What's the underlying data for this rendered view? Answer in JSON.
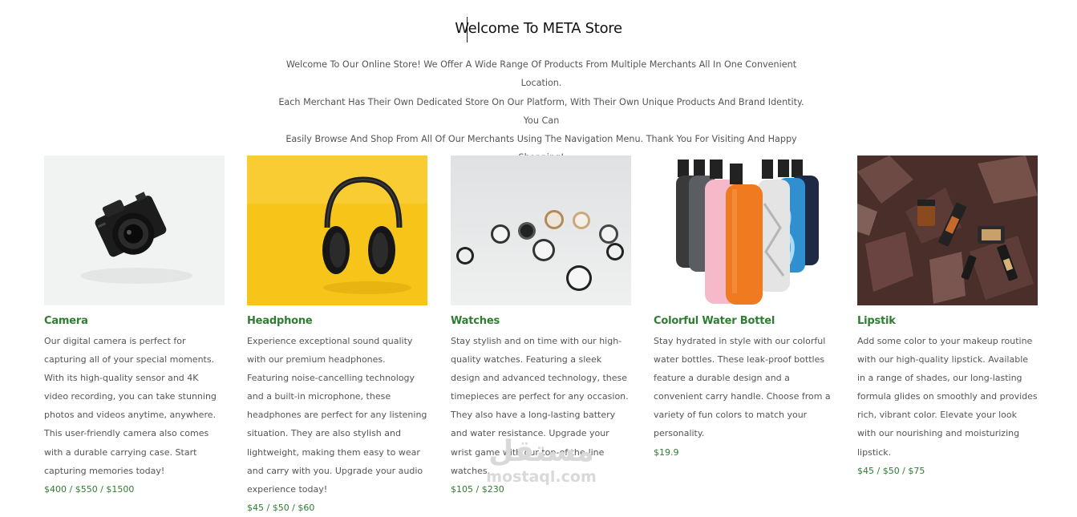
{
  "header": {
    "title": "Welcome To META Store",
    "intro_lines": [
      "Welcome To Our Online Store! We Offer A Wide Range Of Products From Multiple Merchants All In One Convenient Location.",
      "Each Merchant Has Their Own Dedicated Store On Our Platform, With Their Own Unique Products And Brand Identity. You Can",
      "Easily Browse And Shop From All Of Our Merchants Using The Navigation Menu. Thank You For Visiting And Happy Shopping!"
    ]
  },
  "products": [
    {
      "name": "Camera",
      "description": "Our digital camera is perfect for capturing all of your special moments. With its high-quality sensor and 4K video recording, you can take stunning photos and videos anytime, anywhere. This user-friendly camera also comes with a durable carrying case. Start capturing memories today!",
      "price": "$400 / $550 / $1500",
      "image": "camera-photo"
    },
    {
      "name": "Headphone",
      "description": "Experience exceptional sound quality with our premium headphones. Featuring noise-cancelling technology and a built-in microphone, these headphones are perfect for any listening situation. They are also stylish and lightweight, making them easy to wear and carry with you. Upgrade your audio experience today!",
      "price": "$45 / $50 / $60",
      "image": "headphone-photo"
    },
    {
      "name": "Watches",
      "description": "Stay stylish and on time with our high-quality watches. Featuring a sleek design and advanced technology, these timepieces are perfect for any occasion. They also have a long-lasting battery and water resistance. Upgrade your wrist game with our top-of-the-line watches.",
      "price": "$105 / $230",
      "image": "watches-photo"
    },
    {
      "name": "Colorful Water Bottel",
      "description": "Stay hydrated in style with our colorful water bottles. These leak-proof bottles feature a durable design and a convenient carry handle. Choose from a variety of fun colors to match your personality.",
      "price": "$19.9",
      "image": "water-bottles-photo"
    },
    {
      "name": "Lipstik",
      "description": "Add some color to your makeup routine with our high-quality lipstick. Available in a range of shades, our long-lasting formula glides on smoothly and provides rich, vibrant color. Elevate your look with our nourishing and moisturizing lipstick.",
      "price": "$45 / $50 / $75",
      "image": "lipstick-photo"
    }
  ],
  "watermark": {
    "arabic": "مستقل",
    "latin": "mostaql.com"
  },
  "colors": {
    "accent": "#2e7d32",
    "text": "#555555",
    "title": "#111111"
  }
}
